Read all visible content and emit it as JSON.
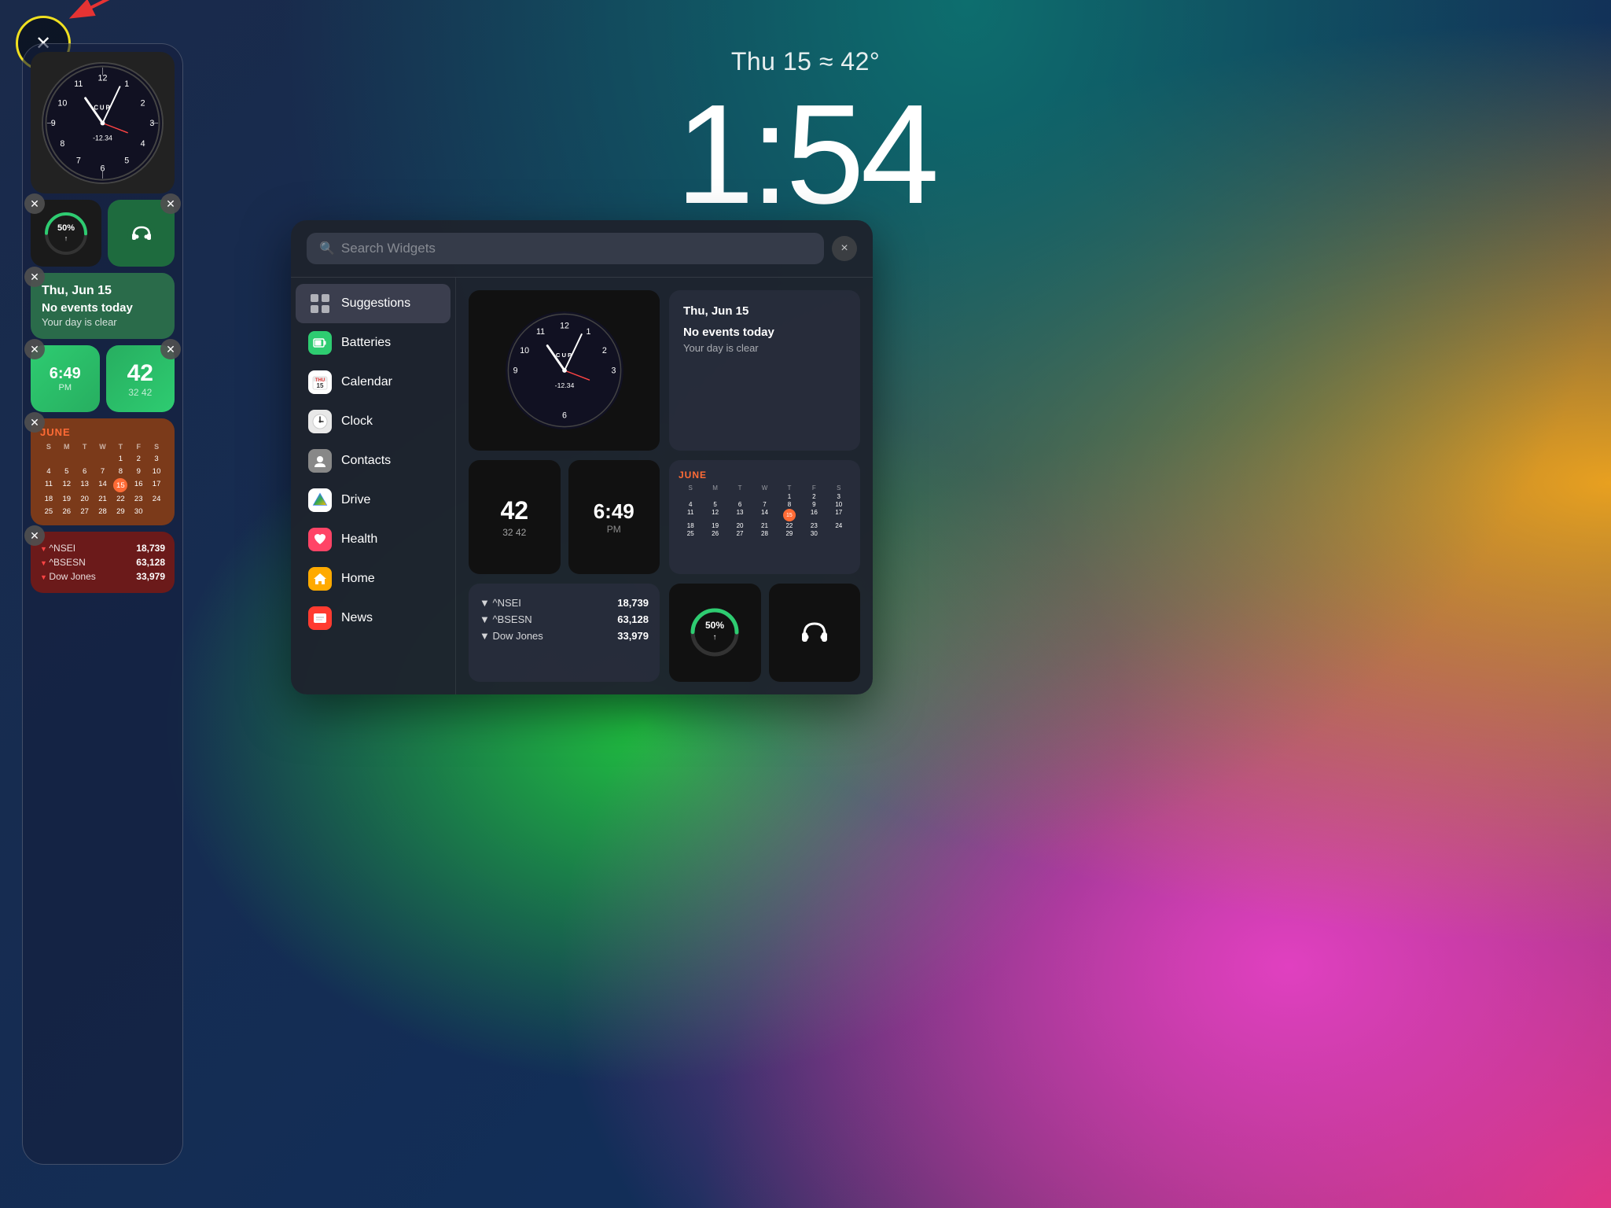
{
  "background": {
    "colors": [
      "#1a2a4a",
      "#0d6e6e",
      "#e8a020",
      "#e040c0",
      "#20c040"
    ]
  },
  "lockscreen": {
    "date": "Thu 15  ≈ 42°",
    "time": "1:54"
  },
  "arrow": {
    "label": "×"
  },
  "sidebar": {
    "clock_widget": {
      "numbers": [
        "11",
        "12",
        "1",
        "2",
        "3",
        "4",
        "5",
        "6",
        "7",
        "8",
        "9",
        "10"
      ],
      "cup": "CUP",
      "temp": "-12.34"
    },
    "battery": {
      "percent": "50%"
    },
    "event": {
      "date": "Thu, Jun 15",
      "title": "No events today",
      "sub": "Your day is clear"
    },
    "weather": {
      "time": "6:49",
      "label": "PM"
    },
    "temp": {
      "value": "42",
      "range": "32  42"
    },
    "calendar": {
      "month": "JUNE",
      "headers": [
        "S",
        "M",
        "T",
        "W",
        "T",
        "F",
        "S"
      ],
      "days": [
        "",
        "",
        "",
        "1",
        "2",
        "3",
        "4",
        "5",
        "6",
        "7",
        "8",
        "9",
        "10",
        "11",
        "12",
        "13",
        "14",
        "15",
        "16",
        "17",
        "18",
        "19",
        "20",
        "21",
        "22",
        "23",
        "24",
        "25",
        "26",
        "27",
        "28",
        "29",
        "30"
      ],
      "today": "15"
    },
    "stocks": {
      "items": [
        {
          "name": "^NSEI",
          "value": "18,739"
        },
        {
          "name": "^BSESN",
          "value": "63,128"
        },
        {
          "name": "Dow Jones",
          "value": "33,979"
        }
      ]
    }
  },
  "panel": {
    "search_placeholder": "Search Widgets",
    "close_label": "×",
    "sidebar_items": [
      {
        "id": "suggestions",
        "label": "Suggestions",
        "icon": "grid",
        "active": true
      },
      {
        "id": "batteries",
        "label": "Batteries",
        "icon": "battery",
        "color": "#2ecc71"
      },
      {
        "id": "calendar",
        "label": "Calendar",
        "icon": "cal",
        "color": "#e8e8e8"
      },
      {
        "id": "clock",
        "label": "Clock",
        "icon": "clock",
        "color": "#e8e8e8"
      },
      {
        "id": "contacts",
        "label": "Contacts",
        "icon": "contacts",
        "color": "#888"
      },
      {
        "id": "drive",
        "label": "Drive",
        "icon": "drive",
        "color": "#fff"
      },
      {
        "id": "health",
        "label": "Health",
        "icon": "health",
        "color": "#ff4466"
      },
      {
        "id": "home",
        "label": "Home",
        "icon": "home",
        "color": "#ffaa00"
      },
      {
        "id": "news",
        "label": "News",
        "icon": "news",
        "color": "#ff3b30"
      }
    ],
    "preview": {
      "calendar_date": "Thu, Jun 15",
      "calendar_event": "No events today",
      "calendar_sub": "Your day is clear",
      "temp_value": "42",
      "temp_range": "32  42",
      "time_value": "6:49",
      "time_label": "PM",
      "stocks": [
        {
          "name": "^NSEI",
          "value": "18,739"
        },
        {
          "name": "^BSESN",
          "value": "63,128"
        },
        {
          "name": "Dow Jones",
          "value": "33,979"
        }
      ],
      "battery_percent": "50%"
    }
  }
}
